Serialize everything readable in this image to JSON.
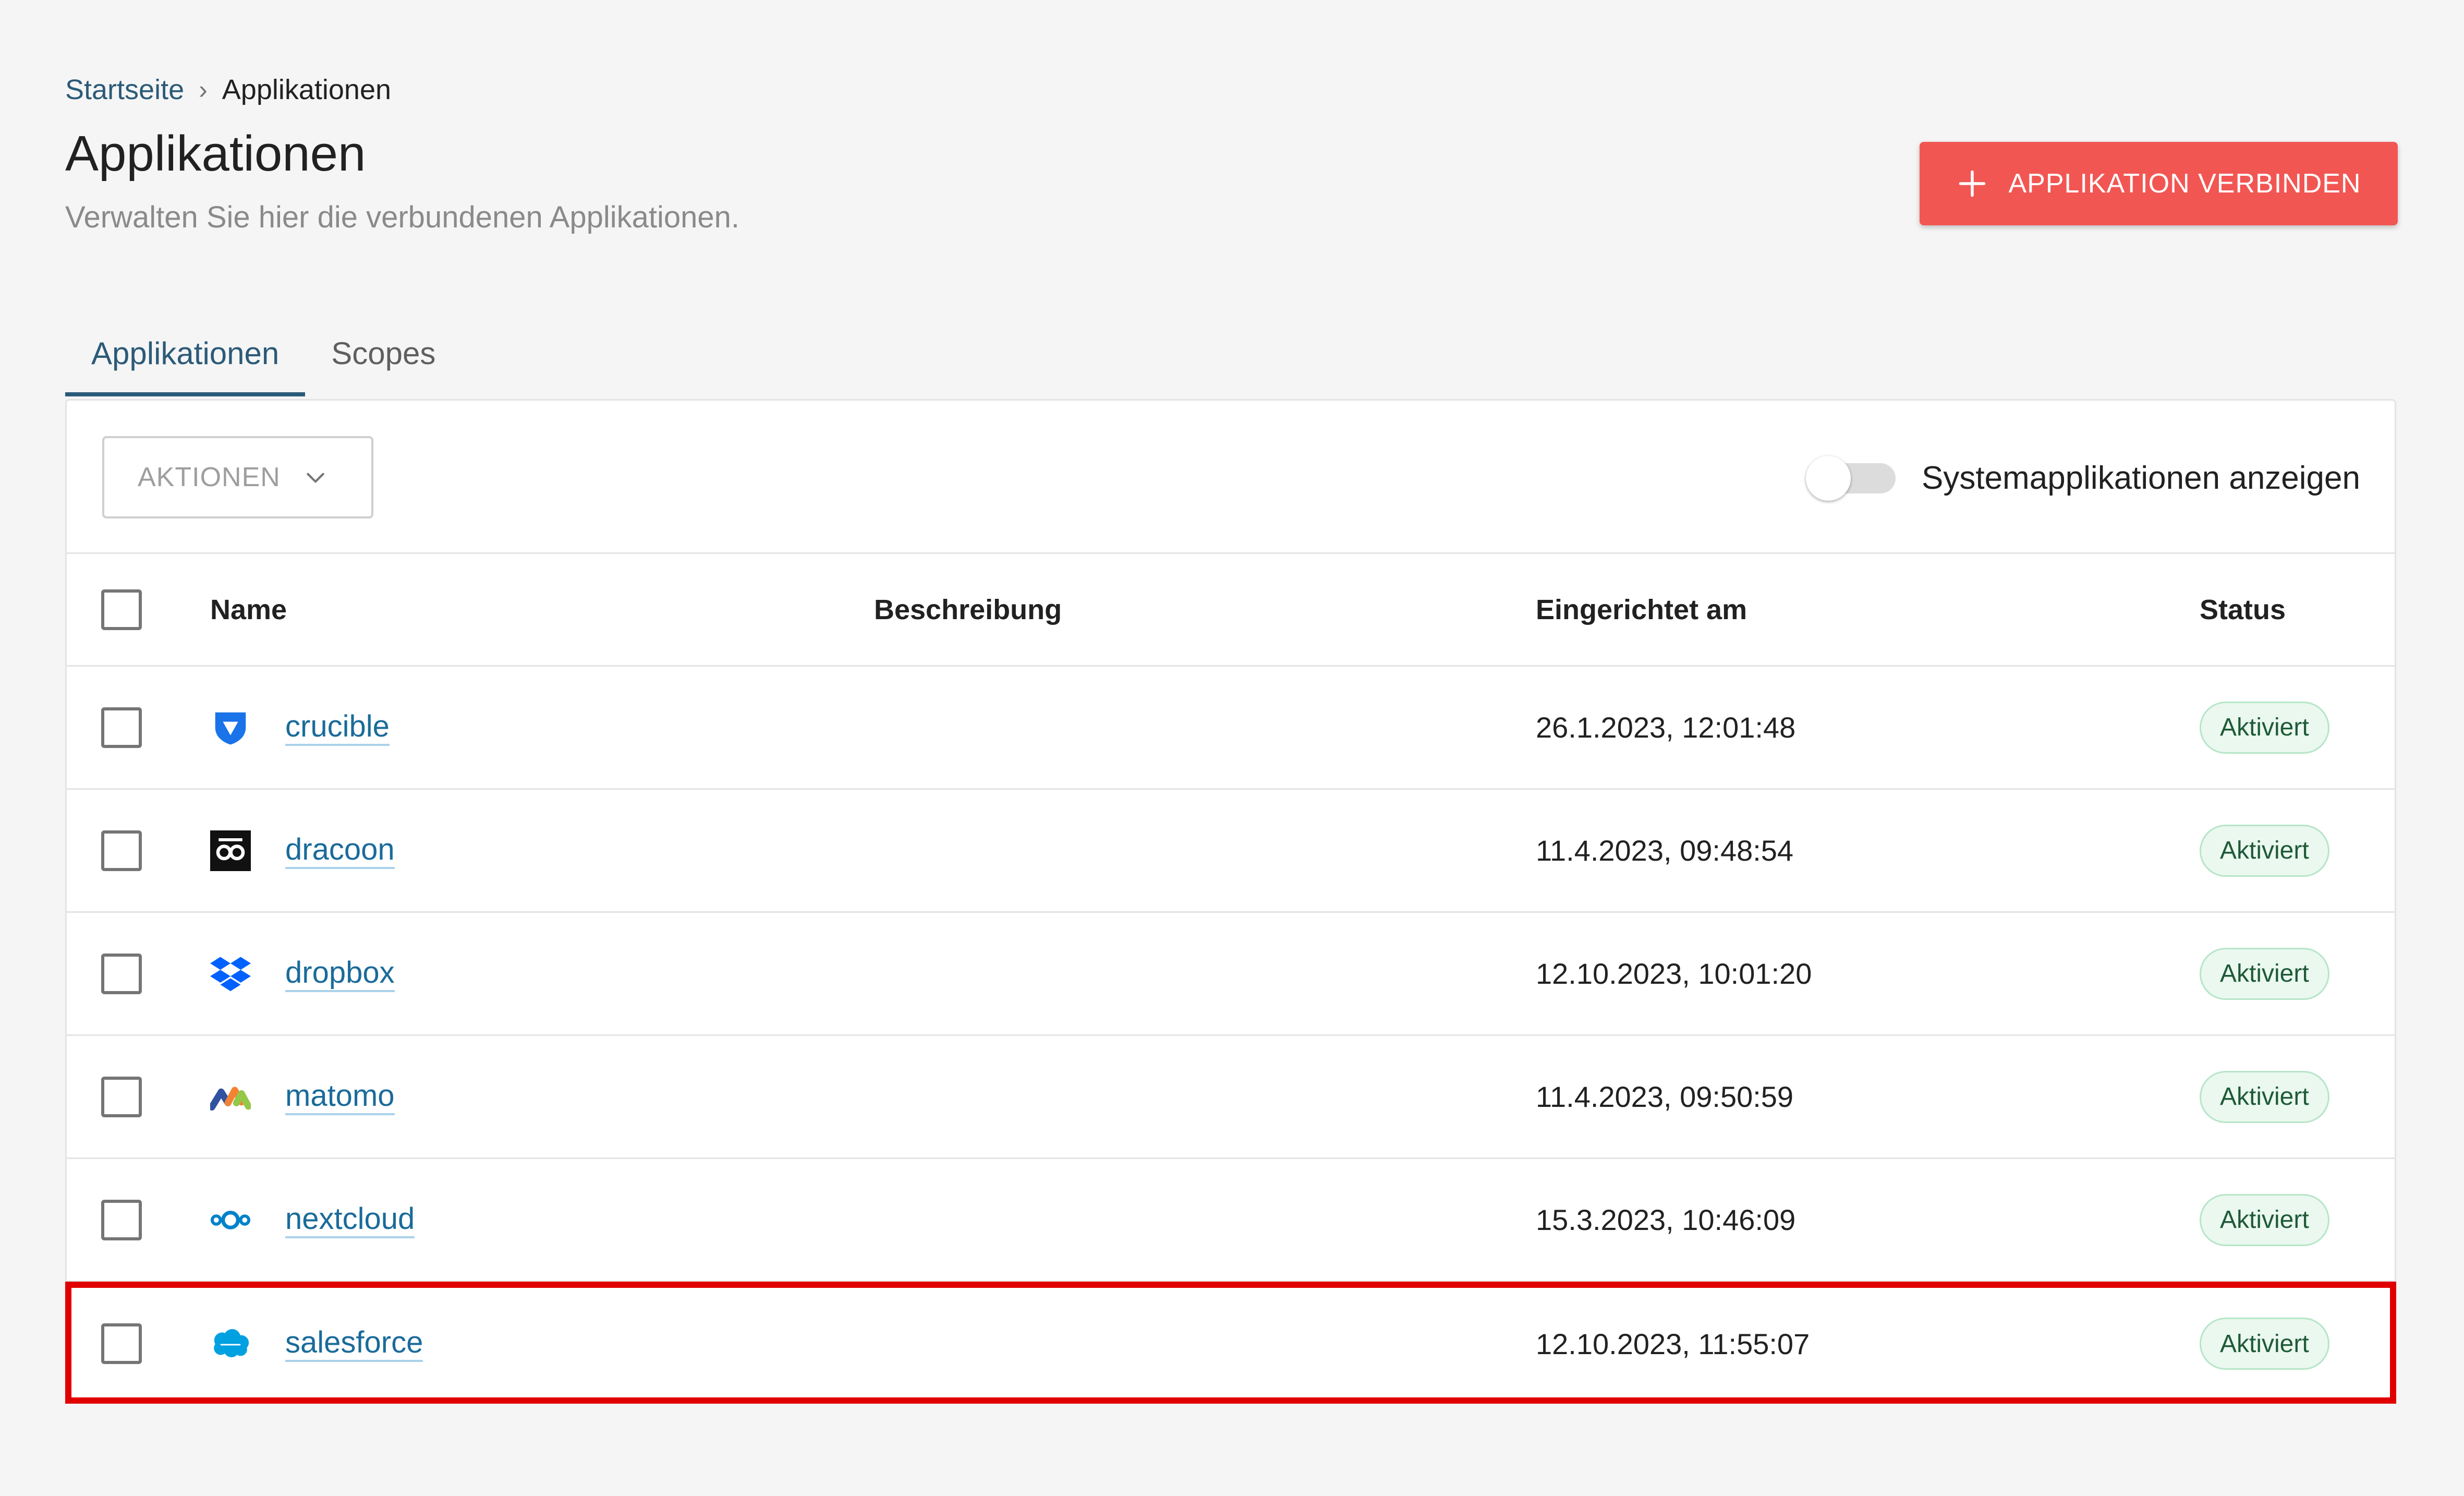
{
  "breadcrumb": {
    "home": "Startseite",
    "separator": "›",
    "current": "Applikationen"
  },
  "header": {
    "title": "Applikationen",
    "subtitle": "Verwalten Sie hier die verbundenen Applikationen.",
    "connect_button": "APPLIKATION VERBINDEN"
  },
  "tabs": [
    {
      "label": "Applikationen",
      "active": true
    },
    {
      "label": "Scopes",
      "active": false
    }
  ],
  "toolbar": {
    "actions_label": "AKTIONEN",
    "toggle_label": "Systemapplikationen anzeigen",
    "toggle_on": false
  },
  "table": {
    "columns": {
      "name": "Name",
      "description": "Beschreibung",
      "created": "Eingerichtet am",
      "status": "Status"
    },
    "rows": [
      {
        "name": "crucible",
        "description": "",
        "created": "26.1.2023, 12:01:48",
        "status": "Aktiviert",
        "icon": "crucible-icon"
      },
      {
        "name": "dracoon",
        "description": "",
        "created": "11.4.2023, 09:48:54",
        "status": "Aktiviert",
        "icon": "dracoon-icon"
      },
      {
        "name": "dropbox",
        "description": "",
        "created": "12.10.2023, 10:01:20",
        "status": "Aktiviert",
        "icon": "dropbox-icon"
      },
      {
        "name": "matomo",
        "description": "",
        "created": "11.4.2023, 09:50:59",
        "status": "Aktiviert",
        "icon": "matomo-icon"
      },
      {
        "name": "nextcloud",
        "description": "",
        "created": "15.3.2023, 10:46:09",
        "status": "Aktiviert",
        "icon": "nextcloud-icon"
      },
      {
        "name": "salesforce",
        "description": "",
        "created": "12.10.2023, 11:55:07",
        "status": "Aktiviert",
        "icon": "salesforce-icon"
      }
    ]
  },
  "colors": {
    "accent": "#2b5a78",
    "primary_button": "#f25653",
    "link": "#1a6b9a",
    "status_bg": "#eaf8ef",
    "highlight": "#e00000"
  }
}
